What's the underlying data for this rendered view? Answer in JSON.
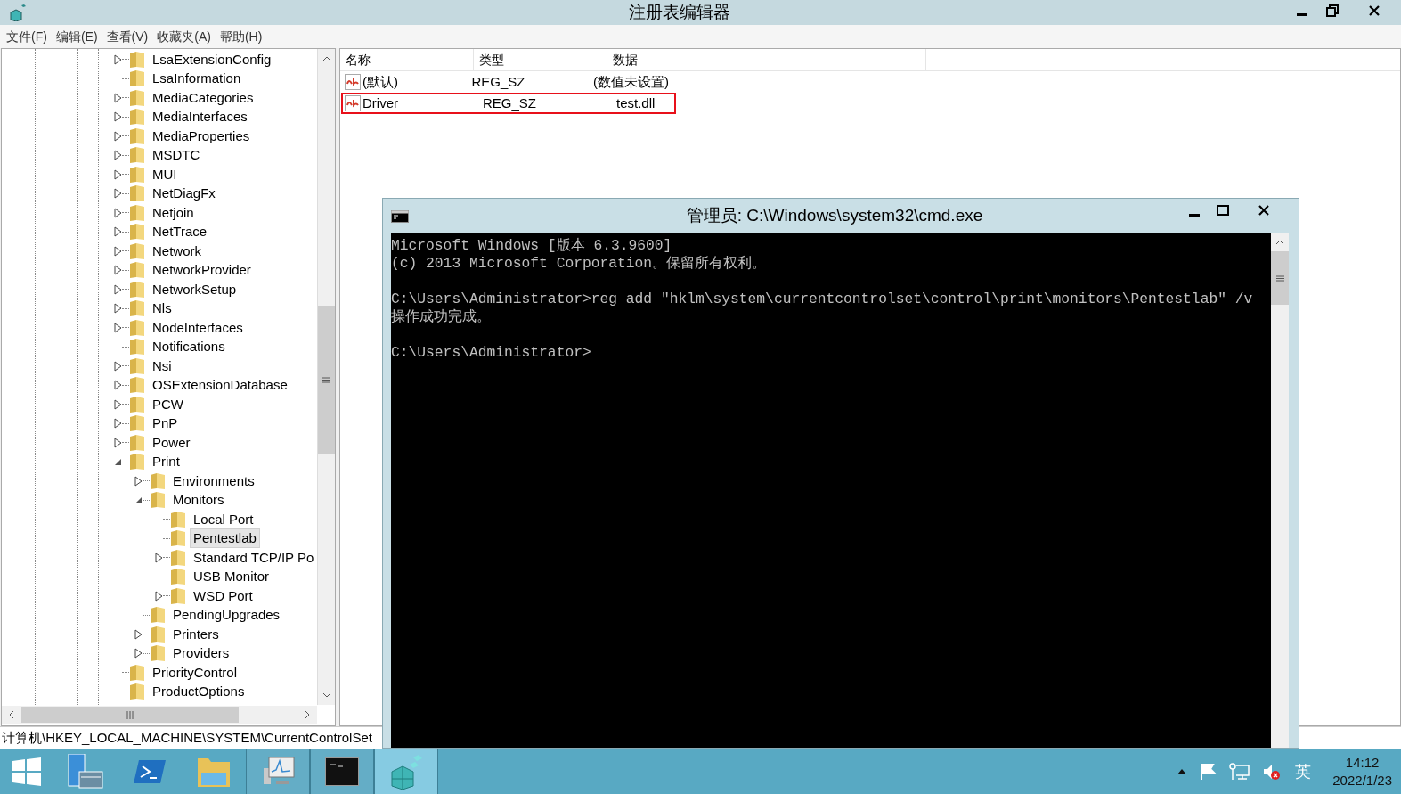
{
  "window": {
    "title": "注册表编辑器"
  },
  "menu": [
    "文件(F)",
    "编辑(E)",
    "查看(V)",
    "收藏夹(A)",
    "帮助(H)"
  ],
  "tree": [
    {
      "label": "LsaExtensionConfig",
      "expandable": true,
      "expanded": false,
      "selected": false
    },
    {
      "label": "LsaInformation",
      "expandable": false,
      "selected": false
    },
    {
      "label": "MediaCategories",
      "expandable": true,
      "expanded": false,
      "selected": false
    },
    {
      "label": "MediaInterfaces",
      "expandable": true,
      "expanded": false,
      "selected": false
    },
    {
      "label": "MediaProperties",
      "expandable": true,
      "expanded": false,
      "selected": false
    },
    {
      "label": "MSDTC",
      "expandable": true,
      "expanded": false,
      "selected": false
    },
    {
      "label": "MUI",
      "expandable": true,
      "expanded": false,
      "selected": false
    },
    {
      "label": "NetDiagFx",
      "expandable": true,
      "expanded": false,
      "selected": false
    },
    {
      "label": "Netjoin",
      "expandable": true,
      "expanded": false,
      "selected": false
    },
    {
      "label": "NetTrace",
      "expandable": true,
      "expanded": false,
      "selected": false
    },
    {
      "label": "Network",
      "expandable": true,
      "expanded": false,
      "selected": false
    },
    {
      "label": "NetworkProvider",
      "expandable": true,
      "expanded": false,
      "selected": false
    },
    {
      "label": "NetworkSetup",
      "expandable": true,
      "expanded": false,
      "selected": false
    },
    {
      "label": "Nls",
      "expandable": true,
      "expanded": false,
      "selected": false
    },
    {
      "label": "NodeInterfaces",
      "expandable": true,
      "expanded": false,
      "selected": false
    },
    {
      "label": "Notifications",
      "expandable": false,
      "selected": false
    },
    {
      "label": "Nsi",
      "expandable": true,
      "expanded": false,
      "selected": false
    },
    {
      "label": "OSExtensionDatabase",
      "expandable": true,
      "expanded": false,
      "selected": false
    },
    {
      "label": "PCW",
      "expandable": true,
      "expanded": false,
      "selected": false
    },
    {
      "label": "PnP",
      "expandable": true,
      "expanded": false,
      "selected": false
    },
    {
      "label": "Power",
      "expandable": true,
      "expanded": false,
      "selected": false
    },
    {
      "label": "Print",
      "expandable": true,
      "expanded": true,
      "selected": false,
      "children": [
        {
          "label": "Environments",
          "expandable": true,
          "expanded": false,
          "selected": false
        },
        {
          "label": "Monitors",
          "expandable": true,
          "expanded": true,
          "selected": false,
          "children": [
            {
              "label": "Local Port",
              "expandable": false,
              "selected": false
            },
            {
              "label": "Pentestlab",
              "expandable": false,
              "selected": true
            },
            {
              "label": "Standard TCP/IP Po",
              "expandable": true,
              "expanded": false,
              "selected": false
            },
            {
              "label": "USB Monitor",
              "expandable": false,
              "selected": false
            },
            {
              "label": "WSD Port",
              "expandable": true,
              "expanded": false,
              "selected": false
            }
          ]
        },
        {
          "label": "PendingUpgrades",
          "expandable": false,
          "selected": false
        },
        {
          "label": "Printers",
          "expandable": true,
          "expanded": false,
          "selected": false
        },
        {
          "label": "Providers",
          "expandable": true,
          "expanded": false,
          "selected": false
        }
      ]
    },
    {
      "label": "PriorityControl",
      "expandable": false,
      "selected": false
    },
    {
      "label": "ProductOptions",
      "expandable": false,
      "selected": false
    }
  ],
  "values_table": {
    "columns": [
      "名称",
      "类型",
      "数据"
    ],
    "rows": [
      {
        "name": "(默认)",
        "type": "REG_SZ",
        "data": "(数值未设置)",
        "highlighted": false
      },
      {
        "name": "Driver",
        "type": "REG_SZ",
        "data": "test.dll",
        "highlighted": true
      }
    ]
  },
  "status_bar": "计算机\\HKEY_LOCAL_MACHINE\\SYSTEM\\CurrentControlSet",
  "cmd_window": {
    "title": "管理员: C:\\Windows\\system32\\cmd.exe",
    "blocks": [
      [
        "Microsoft Windows [版本 6.3.9600]",
        "(c) 2013 Microsoft Corporation。保留所有权利。"
      ],
      [
        "C:\\Users\\Administrator>reg add \"hklm\\system\\currentcontrolset\\control\\print\\monitors\\Pentestlab\" /v",
        "操作成功完成。"
      ],
      [
        "C:\\Users\\Administrator>"
      ]
    ]
  },
  "taskbar": {
    "apps": [
      {
        "kind": "server-manager",
        "running": false,
        "active": false
      },
      {
        "kind": "powershell",
        "running": false,
        "active": false
      },
      {
        "kind": "explorer",
        "running": false,
        "active": false
      },
      {
        "kind": "performance-monitor",
        "running": true,
        "active": false
      },
      {
        "kind": "cmd",
        "running": true,
        "active": false
      },
      {
        "kind": "regedit",
        "running": true,
        "active": true
      }
    ],
    "tray": {
      "ime": "英",
      "time": "14:12",
      "date": "2022/1/23"
    }
  }
}
